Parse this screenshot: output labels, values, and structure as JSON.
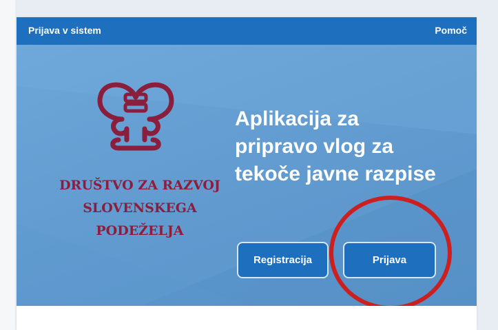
{
  "header": {
    "title": "Prijava v sistem",
    "help_label": "Pomoč"
  },
  "logo": {
    "org_line1": "DRUŠTVO ZA RAZVOJ",
    "org_line2": "SLOVENSKEGA PODEŽELJA",
    "emblem_icon": "heart-knot-emblem-icon",
    "color": "#8b1e3c"
  },
  "hero": {
    "headline_line1": "Aplikacija za",
    "headline_line2": "pripravo vlog za",
    "headline_line3": "tekoče javne razpise"
  },
  "buttons": {
    "register_label": "Registracija",
    "login_label": "Prijava"
  },
  "colors": {
    "header_blue": "#1f6fbf",
    "hero_blue": "#6da6d8",
    "highlight_red": "#cc1f1f"
  }
}
